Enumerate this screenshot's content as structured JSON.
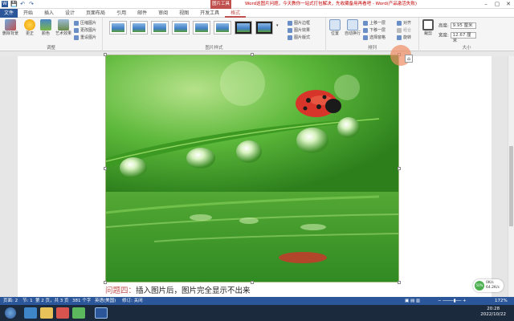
{
  "window": {
    "context_tab": "图片工具",
    "title": "Word这图片问题，今天教你一站式打包解决，先收藏备用再看吧 - Word(产品激活失败)",
    "controls": {
      "minimize": "–",
      "restore": "▢",
      "close": "✕"
    }
  },
  "quick_access": {
    "save": "💾",
    "undo": "↶",
    "redo": "↷"
  },
  "tabs": [
    "文件",
    "开始",
    "插入",
    "设计",
    "页面布局",
    "引用",
    "邮件",
    "审阅",
    "视图",
    "开发工具",
    "格式"
  ],
  "ribbon": {
    "adjust": {
      "label": "调整",
      "remove_bg": "删除背景",
      "corrections": "更正",
      "color": "颜色",
      "artistic": "艺术效果",
      "compress": "压缩图片",
      "change": "更改图片",
      "reset": "重设图片"
    },
    "styles": {
      "label": "图片样式",
      "border": "图片边框",
      "effects": "图片效果",
      "layout": "图片版式"
    },
    "arrange": {
      "label": "排列",
      "position": "位置",
      "wrap": "自动换行",
      "forward": "上移一层",
      "backward": "下移一层",
      "selection": "选择窗格",
      "align": "对齐",
      "group": "组合",
      "rotate": "旋转"
    },
    "size": {
      "label": "大小",
      "crop": "裁剪",
      "height_label": "高度:",
      "height_value": "9.95 厘米",
      "width_label": "宽度:",
      "width_value": "12.67 厘米"
    }
  },
  "document": {
    "caption_label": "问题四：",
    "caption_text": "插入图片后，图片完全显示不出来"
  },
  "statusbar": {
    "page": "页面: 2",
    "section": "节: 1",
    "page_of": "第 2 页，共 3 页",
    "words": "381 个字",
    "lang": "英语(美国)",
    "track": "修订: 关闭",
    "zoom": "172%"
  },
  "net_widget": {
    "percent": "50%",
    "up": "0K/s",
    "down": "64.2K/s"
  },
  "taskbar": {
    "time": "20:28",
    "date": "2022/10/22"
  },
  "colors": {
    "accent": "#2b579a",
    "context": "#c0504d",
    "title_text": "#c00000"
  }
}
